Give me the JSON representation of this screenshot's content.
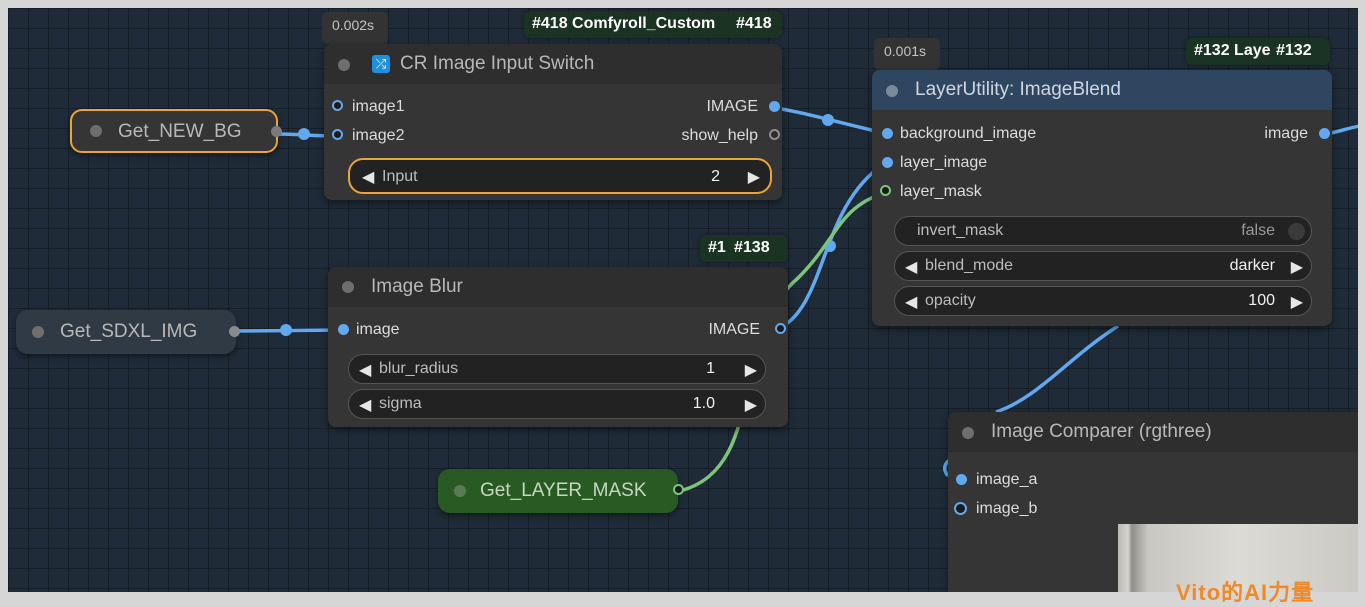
{
  "colors": {
    "link_image": "#62a8ee",
    "link_mask": "#7dc47a",
    "selection": "#e9a43a",
    "canvas": "#1f2b38"
  },
  "nodes": {
    "cr_switch": {
      "badge_full": "#418 Comfyroll_Custom",
      "badge_id": "#418",
      "timer": "0.002s",
      "icon": "shuffle-icon",
      "title": "CR Image Input Switch",
      "inputs": [
        "image1",
        "image2"
      ],
      "outputs": [
        "IMAGE",
        "show_help"
      ],
      "widget": {
        "label": "Input",
        "value": "2"
      }
    },
    "layer_blend": {
      "badge_full": "#132 Laye",
      "badge_id": "#132",
      "timer": "0.001s",
      "title": "LayerUtility: ImageBlend",
      "inputs": [
        "background_image",
        "layer_image",
        "layer_mask"
      ],
      "outputs": [
        "image"
      ],
      "widgets": [
        {
          "label": "invert_mask",
          "value": "false"
        },
        {
          "label": "blend_mode",
          "value": "darker"
        },
        {
          "label": "opacity",
          "value": "100"
        }
      ]
    },
    "image_blur": {
      "badge_full": "#1",
      "badge_id": "#138",
      "title": "Image Blur",
      "inputs": [
        "image"
      ],
      "outputs": [
        "IMAGE"
      ],
      "widgets": [
        {
          "label": "blur_radius",
          "value": "1"
        },
        {
          "label": "sigma",
          "value": "1.0"
        }
      ]
    },
    "comparer": {
      "title": "Image Comparer (rgthree)",
      "inputs": [
        "image_a",
        "image_b"
      ]
    }
  },
  "getters": {
    "new_bg": "Get_NEW_BG",
    "sdxl_img": "Get_SDXL_IMG",
    "layer_mask": "Get_LAYER_MASK"
  },
  "watermark": "Vito的AI力量"
}
